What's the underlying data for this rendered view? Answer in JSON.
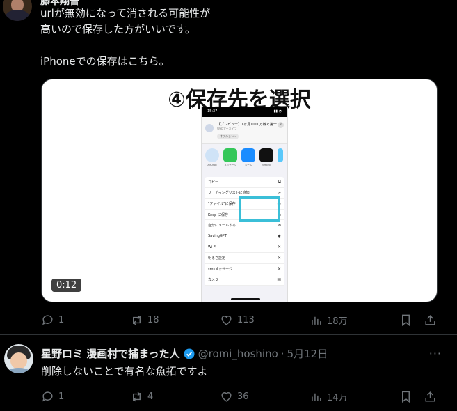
{
  "tweet1": {
    "author": "藤本翔吾",
    "lines": [
      "urlが無効になって消される可能性が",
      "高いので保存した方がいいです。",
      "",
      "iPhoneでの保存はこちら。"
    ],
    "media": {
      "title": "④保存先を選択",
      "duration": "0:12",
      "phone": {
        "time": "15:37",
        "share_title": "【プレビュー】1ヶ月1000万稼ぐ第一",
        "share_subtitle": "Webアーカイブ",
        "options": "オプション ›",
        "apps": [
          "AirDrop",
          "メッセージ",
          "メール",
          "Webex"
        ],
        "rows": [
          {
            "label": "コピー",
            "icon": "⧉"
          },
          {
            "label": "リーディングリストに追加",
            "icon": "∞"
          },
          {
            "label": "\"ファイル\"に保存",
            "icon": "▭"
          },
          {
            "label": "Keep に保存",
            "icon": "▪"
          },
          {
            "label": "自分にメールする",
            "icon": "✉"
          },
          {
            "label": "SavingGPT",
            "icon": "✸"
          },
          {
            "label": "Wi-Fi",
            "icon": "✕"
          },
          {
            "label": "明るさ設定",
            "icon": "✕"
          },
          {
            "label": "smsメッセージ",
            "icon": "✕"
          },
          {
            "label": "カメラ",
            "icon": "▤"
          }
        ]
      }
    },
    "stats": {
      "replies": "1",
      "reposts": "18",
      "likes": "113",
      "views": "18万"
    }
  },
  "tweet2": {
    "name": "星野ロミ 漫画村で捕まった人",
    "handle": "@romi_hoshino",
    "separator": "·",
    "date": "5月12日",
    "text": "削除しないことで有名な魚拓ですよ",
    "stats": {
      "replies": "1",
      "reposts": "4",
      "likes": "36",
      "views": "14万"
    }
  },
  "colors": {
    "background": "#000000",
    "text": "#e7e9ea",
    "muted": "#71767b",
    "verified": "#1d9bf0",
    "highlight": "#3bbfd8"
  },
  "icons": [
    "reply-icon",
    "repost-icon",
    "like-icon",
    "views-icon",
    "bookmark-icon",
    "share-icon",
    "verified-icon",
    "more-icon"
  ]
}
